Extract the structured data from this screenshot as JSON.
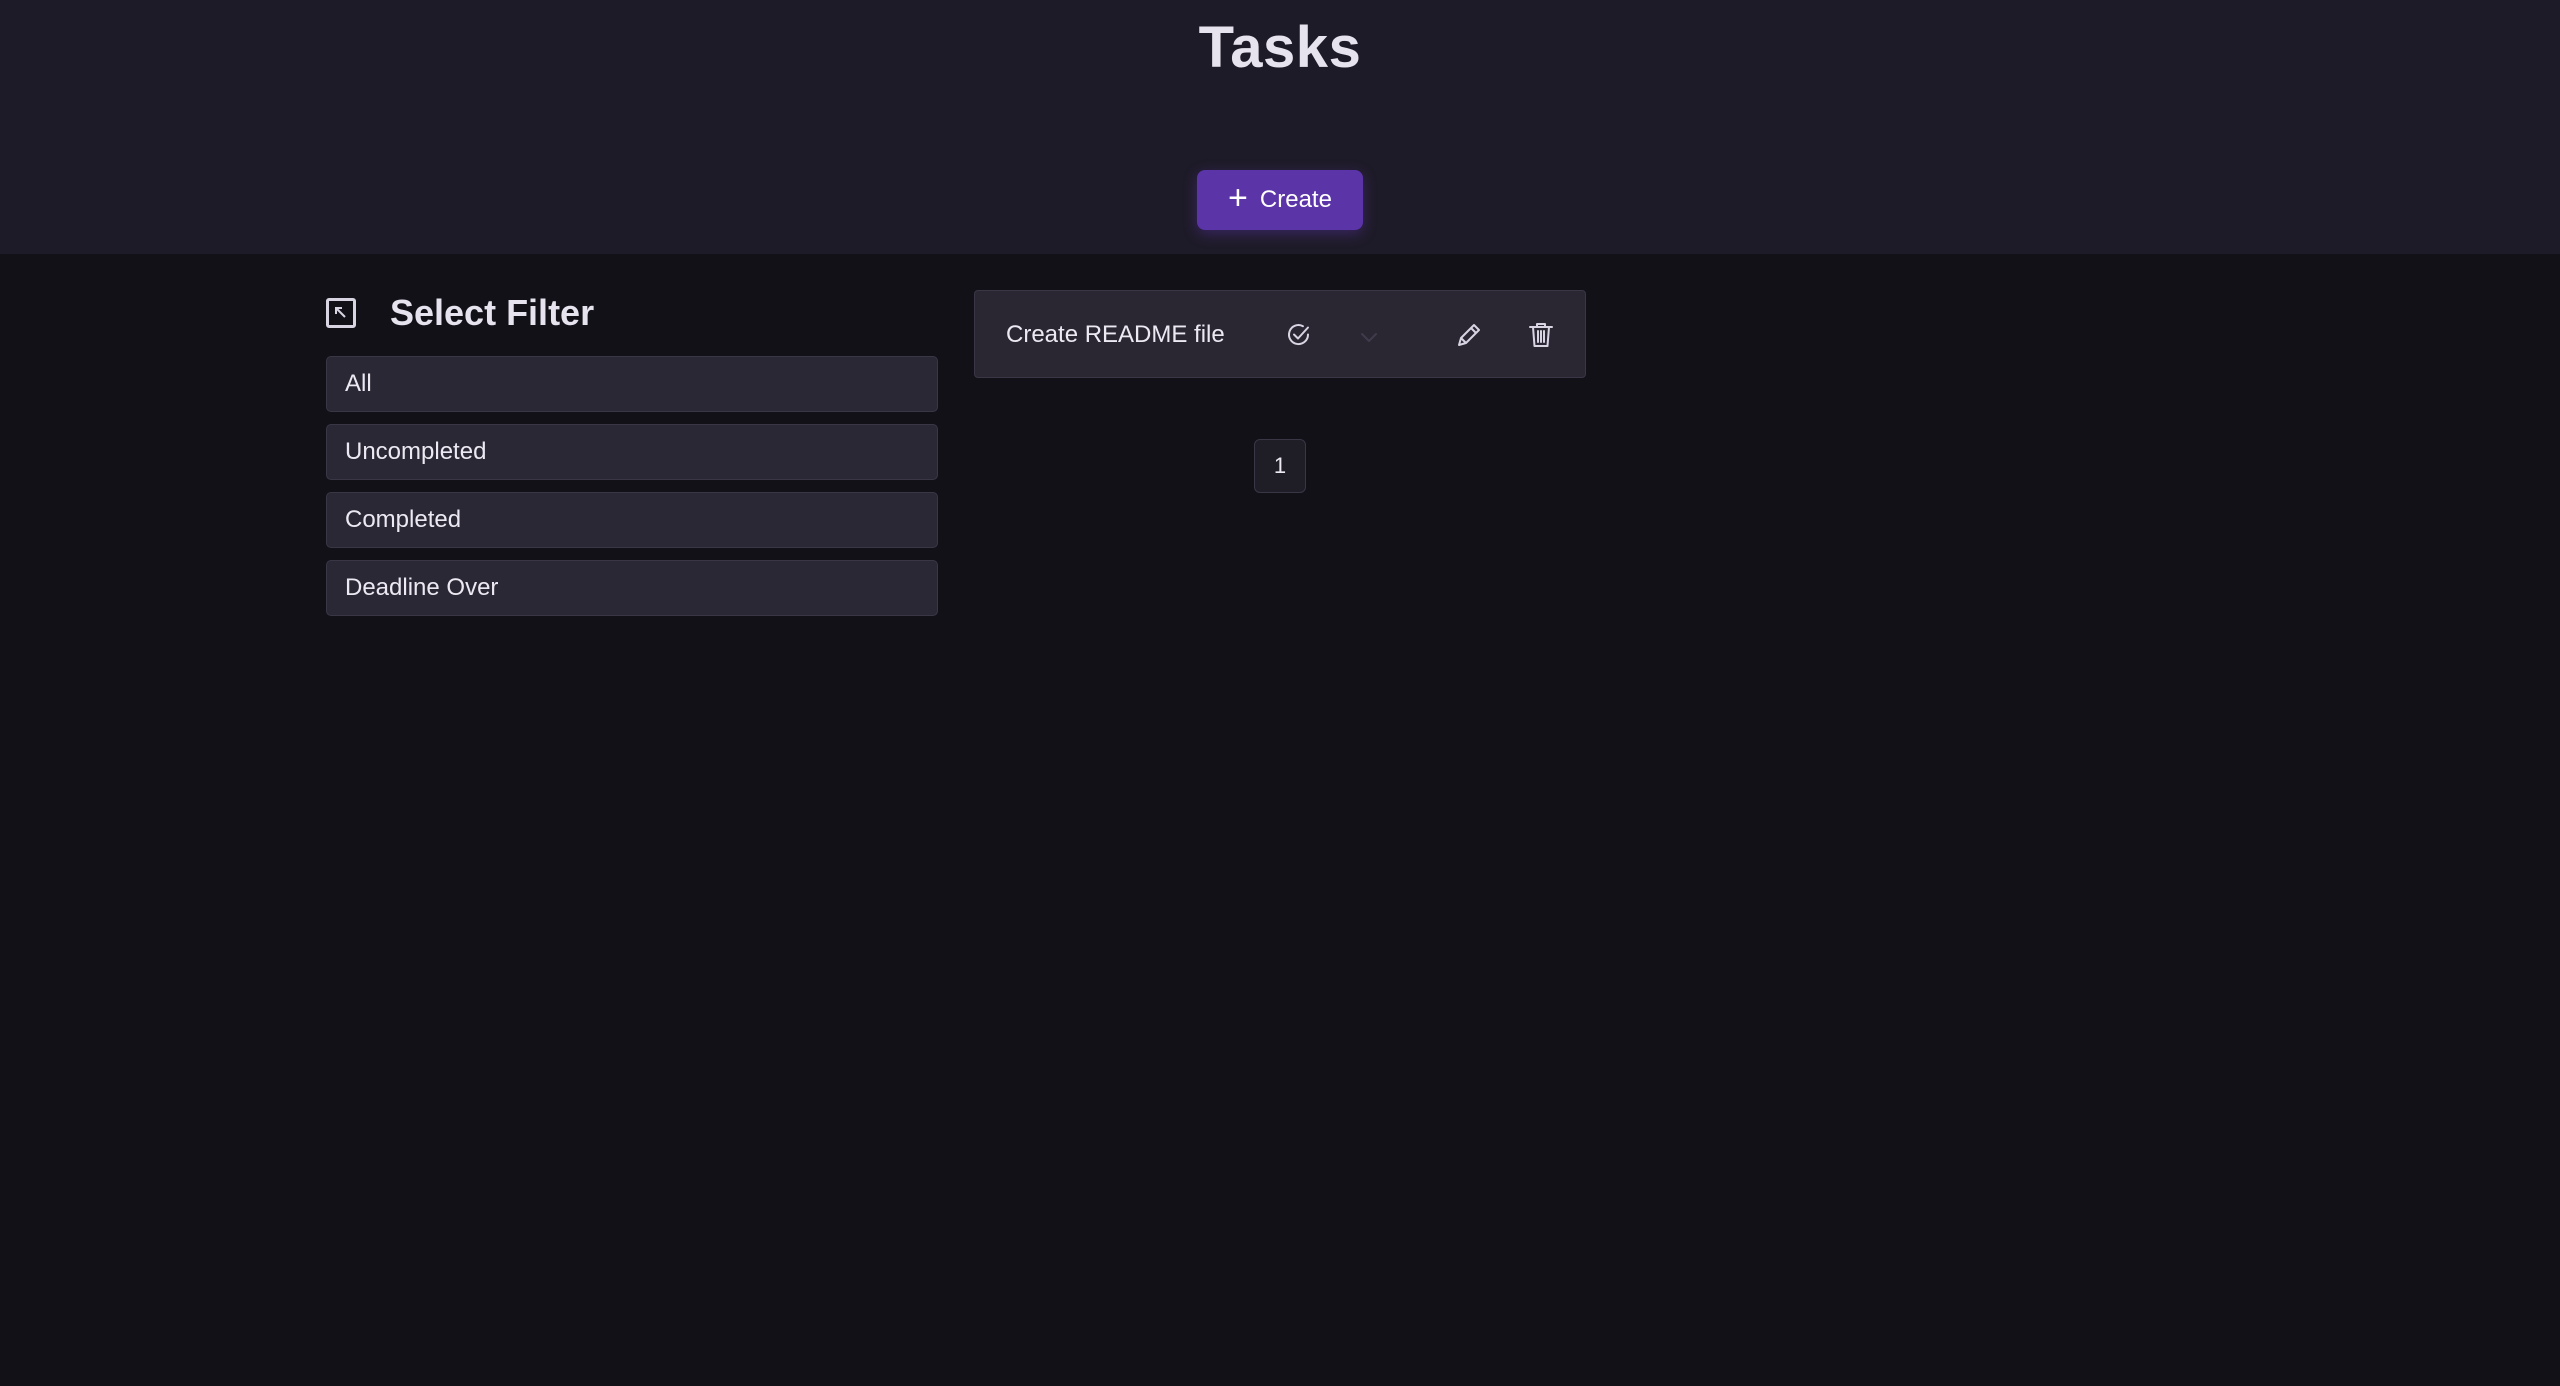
{
  "header": {
    "title": "Tasks",
    "create_button": {
      "label": "Create",
      "icon": "plus-icon"
    }
  },
  "filters": {
    "title": "Select Filter",
    "collapse_icon": "collapse-arrow-icon",
    "items": [
      {
        "label": "All"
      },
      {
        "label": "Uncompleted"
      },
      {
        "label": "Completed"
      },
      {
        "label": "Deadline Over"
      }
    ]
  },
  "tasks": [
    {
      "title": "Create README file",
      "icons": [
        "check-circle-icon",
        "chevron-down-icon",
        "pencil-icon",
        "trash-icon"
      ]
    }
  ],
  "pagination": {
    "current_page": "1"
  },
  "colors": {
    "accent": "#5b34a8",
    "header_bg": "#1e1b28",
    "page_bg": "#121118",
    "item_bg": "#2b2836"
  }
}
